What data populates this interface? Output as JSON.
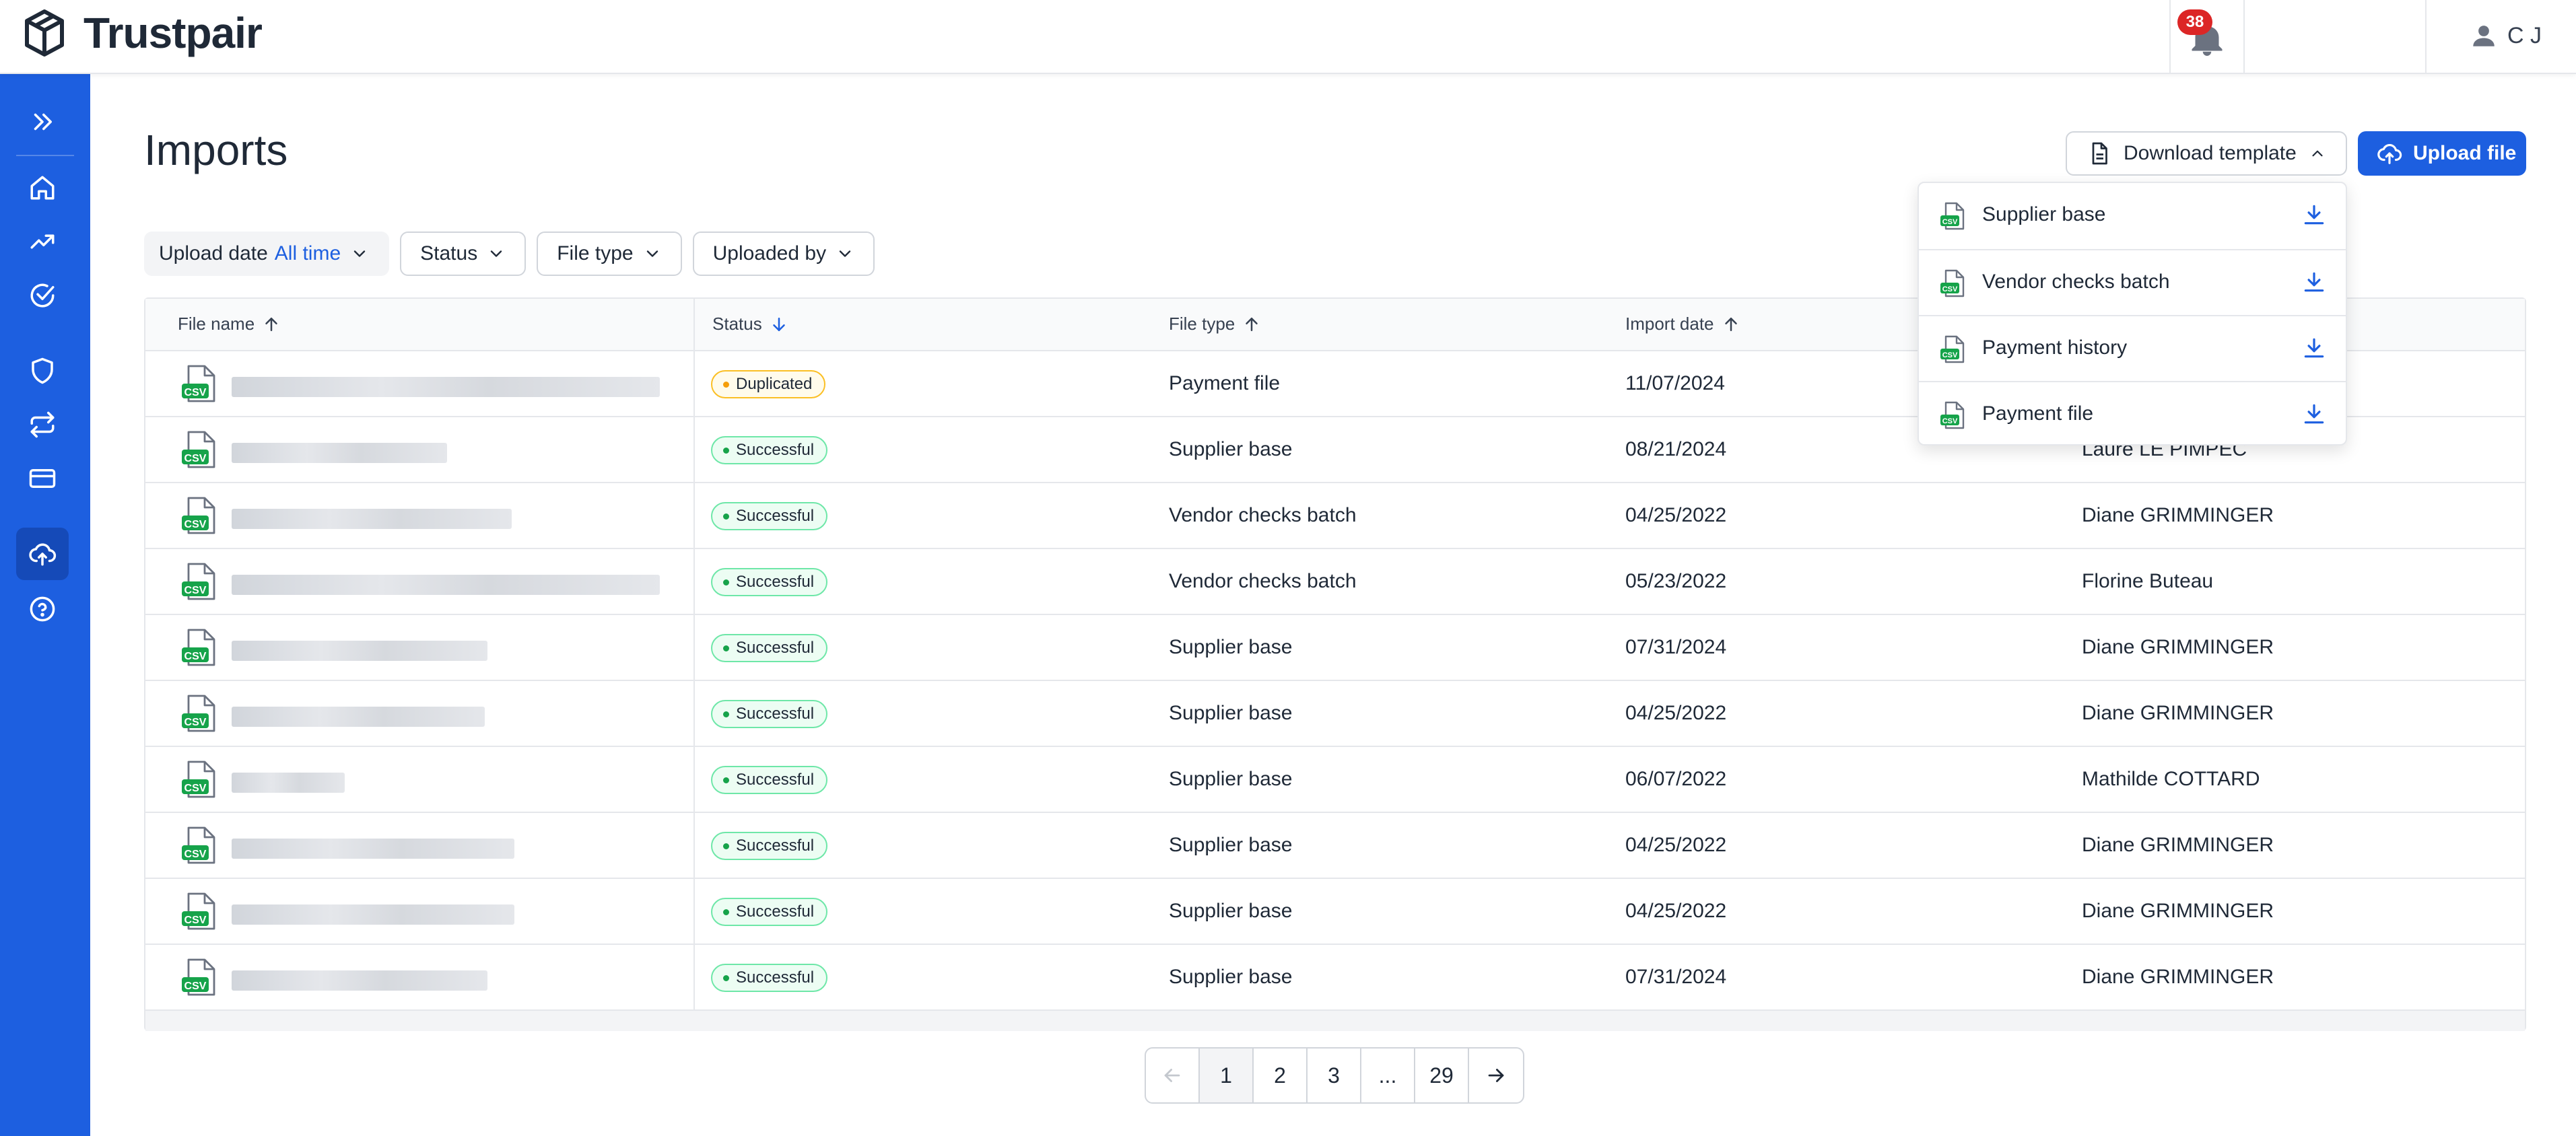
{
  "header": {
    "brand": "Trustpair",
    "notifications_count": "38",
    "user_initials": "C J"
  },
  "sidebar": {
    "items": [
      {
        "icon": "expand-icon"
      },
      {
        "icon": "home-icon"
      },
      {
        "icon": "trending-icon"
      },
      {
        "icon": "check-circle-icon"
      },
      {
        "icon": "shield-icon"
      },
      {
        "icon": "transfer-icon"
      },
      {
        "icon": "card-icon"
      },
      {
        "icon": "upload-cloud-icon",
        "active": true
      },
      {
        "icon": "help-icon"
      }
    ]
  },
  "page": {
    "title": "Imports",
    "download_template_label": "Download template",
    "upload_file_label": "Upload file"
  },
  "filters": {
    "upload_date_label": "Upload date",
    "upload_date_value": "All time",
    "status": "Status",
    "file_type": "File type",
    "uploaded_by": "Uploaded by"
  },
  "table": {
    "columns": {
      "file_name": "File name",
      "status": "Status",
      "file_type": "File type",
      "import_date": "Import date"
    },
    "rows": [
      {
        "status": "Duplicated",
        "file_type": "Payment file",
        "import_date": "11/07/2024",
        "uploaded_by": ""
      },
      {
        "status": "Successful",
        "file_type": "Supplier base",
        "import_date": "08/21/2024",
        "uploaded_by": "Laure LE PIMPEC"
      },
      {
        "status": "Successful",
        "file_type": "Vendor checks batch",
        "import_date": "04/25/2022",
        "uploaded_by": "Diane GRIMMINGER"
      },
      {
        "status": "Successful",
        "file_type": "Vendor checks batch",
        "import_date": "05/23/2022",
        "uploaded_by": "Florine Buteau"
      },
      {
        "status": "Successful",
        "file_type": "Supplier base",
        "import_date": "07/31/2024",
        "uploaded_by": "Diane GRIMMINGER"
      },
      {
        "status": "Successful",
        "file_type": "Supplier base",
        "import_date": "04/25/2022",
        "uploaded_by": "Diane GRIMMINGER"
      },
      {
        "status": "Successful",
        "file_type": "Supplier base",
        "import_date": "06/07/2022",
        "uploaded_by": "Mathilde COTTARD"
      },
      {
        "status": "Successful",
        "file_type": "Supplier base",
        "import_date": "04/25/2022",
        "uploaded_by": "Diane GRIMMINGER"
      },
      {
        "status": "Successful",
        "file_type": "Supplier base",
        "import_date": "04/25/2022",
        "uploaded_by": "Diane GRIMMINGER"
      },
      {
        "status": "Successful",
        "file_type": "Supplier base",
        "import_date": "07/31/2024",
        "uploaded_by": "Diane GRIMMINGER"
      }
    ]
  },
  "template_menu": {
    "items": [
      "Supplier base",
      "Vendor checks batch",
      "Payment history",
      "Payment file"
    ]
  },
  "pagination": {
    "pages": [
      "1",
      "2",
      "3",
      "...",
      "29"
    ],
    "current": "1"
  },
  "colors": {
    "brand_blue": "#1d5fe0",
    "success": "#16a34a",
    "warning": "#f59e0b",
    "badge_red": "#dc2626"
  }
}
